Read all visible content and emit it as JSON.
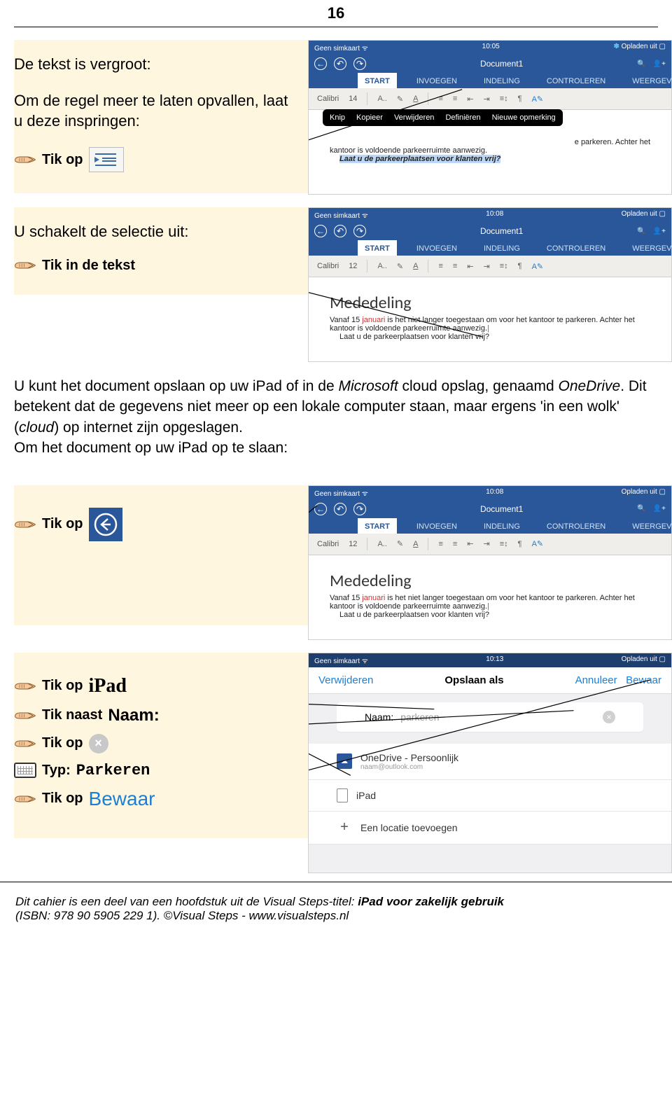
{
  "page_number": "16",
  "section1": {
    "heading": "De tekst is vergroot:",
    "body": "Om de regel meer te laten opvallen, laat u deze inspringen:",
    "step": "Tik op"
  },
  "section2": {
    "heading": "U schakelt de selectie uit:",
    "step": "Tik in de tekst"
  },
  "middle_para": {
    "l1": "U kunt het document opslaan op uw iPad of in de ",
    "l1i": "Microsoft",
    "l1b": " cloud opslag, genaamd ",
    "l1c": "OneDrive",
    "l2": ". Dit betekent dat de gegevens niet meer op een lokale computer staan, maar ergens 'in een wolk' (",
    "l2i": "cloud",
    "l2b": ") op internet zijn opgeslagen.",
    "l3": "Om het document op uw iPad op te slaan:"
  },
  "section3": {
    "step": "Tik op"
  },
  "section4": {
    "s1": "Tik op",
    "s1v": "iPad",
    "s2": "Tik naast",
    "s2v": "Naam:",
    "s3": "Tik op",
    "s4": "Typ:",
    "s4v": "Parkeren",
    "s5": "Tik op",
    "s5v": "Bewaar"
  },
  "statusbar": {
    "left": "Geen simkaart ᯤ",
    "battery": "Opladen uit ▢"
  },
  "times": {
    "t1": "10:05",
    "t2": "10:08",
    "t3": "10:08",
    "t4": "10:13"
  },
  "doc": {
    "name": "Document1",
    "tabs": {
      "start": "START",
      "invoegen": "INVOEGEN",
      "indeling": "INDELING",
      "controleren": "CONTROLEREN",
      "weergeven": "WEERGEVEN"
    },
    "font": "Calibri",
    "size12": "12",
    "size14": "14",
    "title": "Mededeling",
    "line1a": "Vanaf 15 ",
    "line1b": "januari",
    "line1c": " is het niet langer toegestaan om voor het kantoor te parkeren. Achter het kantoor is voldoende parkeerruimte aanwezig.",
    "line2": "Laat u de parkeerplaatsen voor klanten vrij?",
    "line1short": "e parkeren. Achter het",
    "line1short2": "kantoor is voldoende parkeerruimte aanwezig."
  },
  "context": {
    "knip": "Knip",
    "kopieer": "Kopieer",
    "verwijder": "Verwijderen",
    "def": "Definiëren",
    "nieuw": "Nieuwe opmerking"
  },
  "save": {
    "delete": "Verwijderen",
    "title": "Opslaan als",
    "cancel": "Annuleer",
    "save": "Bewaar",
    "name_label": "Naam:",
    "name_val": "parkeren",
    "onedrive": "OneDrive - Persoonlijk",
    "email": "naam@outlook.com",
    "ipad": "iPad",
    "addloc": "Een locatie toevoegen"
  },
  "footer": {
    "l1a": "Dit cahier is een deel van een hoofdstuk uit de Visual Steps-titel: ",
    "l1b": "iPad voor zakelijk gebruik",
    "l2": "(ISBN: 978 90 5905 229 1). ©Visual Steps - www.visualsteps.nl"
  }
}
